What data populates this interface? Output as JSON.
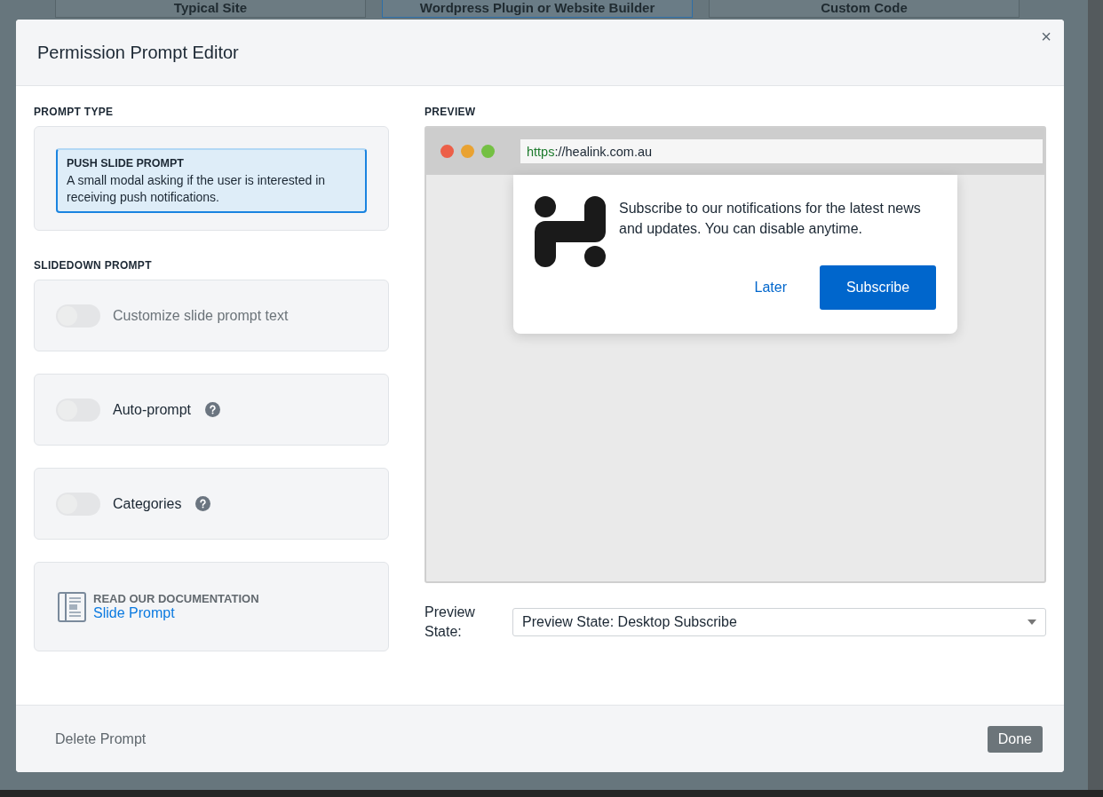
{
  "background_tabs": [
    {
      "label": "Typical Site",
      "selected": false
    },
    {
      "label": "Wordpress Plugin or Website Builder",
      "selected": true
    },
    {
      "label": "Custom Code",
      "selected": false
    }
  ],
  "dialog": {
    "title": "Permission Prompt Editor",
    "close": "×"
  },
  "prompt_type": {
    "heading": "PROMPT TYPE",
    "options": [
      {
        "title": "PUSH SLIDE PROMPT",
        "description": "A small modal asking if the user is interested in receiving push notifications.",
        "selected": true
      }
    ]
  },
  "slidedown": {
    "heading": "SLIDEDOWN PROMPT",
    "settings": [
      {
        "label": "Customize slide prompt text",
        "on": false,
        "disabled": true,
        "help": false
      },
      {
        "label": "Auto-prompt",
        "on": false,
        "disabled": false,
        "help": true
      },
      {
        "label": "Categories",
        "on": false,
        "disabled": false,
        "help": true
      }
    ]
  },
  "documentation": {
    "heading": "READ OUR DOCUMENTATION",
    "link": "Slide Prompt"
  },
  "preview": {
    "heading": "PREVIEW",
    "url_scheme": "https",
    "url_rest": "://healink.com.au",
    "message": "Subscribe to our notifications for the latest news and updates. You can disable anytime.",
    "later": "Later",
    "subscribe": "Subscribe"
  },
  "preview_state": {
    "label": "Preview State:",
    "value": "Preview State: Desktop Subscribe"
  },
  "footer": {
    "delete": "Delete Prompt",
    "done": "Done"
  }
}
